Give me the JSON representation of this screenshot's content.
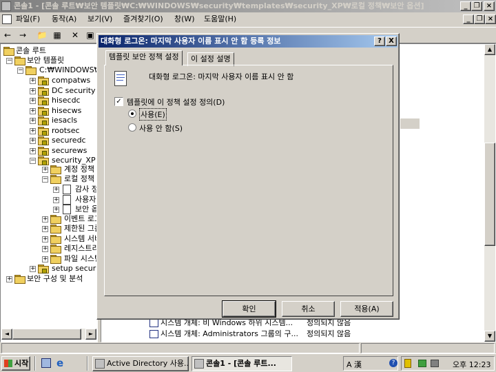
{
  "window": {
    "title": "콘솔1 - [콘솔 루트₩보안 템플릿₩C:₩WINDOWS₩security₩templates₩security_XP₩로컬 정책₩보안 옵션]"
  },
  "menu": {
    "items": [
      "파일(F)",
      "동작(A)",
      "보기(V)",
      "즐겨찾기(O)",
      "창(W)",
      "도움말(H)"
    ]
  },
  "tree": {
    "root": "콘솔 루트",
    "security_templates": "보안 템플릿",
    "templates_path": "C:₩WINDOWS₩security₩templates",
    "templates": [
      "compatws",
      "DC security",
      "hisecdc",
      "hisecws",
      "iesacls",
      "rootsec",
      "securedc",
      "securews",
      "security_XP"
    ],
    "xp_children": [
      "계정 정책",
      "로컬 정책",
      "이벤트 로그",
      "제한된 그룹",
      "시스템 서비스",
      "레지스트리",
      "파일 시스템"
    ],
    "local_policy_children": [
      "감사 정책",
      "사용자 권한 할당",
      "보안 옵션"
    ],
    "setup_security": "setup security",
    "analysis": "보안 구성 및 분석"
  },
  "right_list": {
    "rows": [
      {
        "name": "시스템 개체: 비 Windows 하위 시스템...",
        "value": "정의되지 않음"
      },
      {
        "name": "시스템 개체: Administrators 그룹의 구...",
        "value": "정의되지 않음"
      }
    ]
  },
  "dialog": {
    "title": "대화형 로그온: 마지막 사용자 이름 표시 안 함 등록 정보",
    "tabs": [
      "템플릿 보안 정책 설정",
      "이 설정 설명"
    ],
    "policy_name": "대화형 로그온: 마지막 사용자 이름 표시 안 함",
    "define_checkbox": "템플릿에 이 정책 설정 정의(D)",
    "define_checked": true,
    "radio_enable": "사용(E)",
    "radio_disable": "사용 안 함(S)",
    "selected": "enable",
    "ok": "확인",
    "cancel": "취소",
    "apply": "적용(A)",
    "help": "?",
    "close": "X"
  },
  "taskbar": {
    "start": "시작",
    "tasks": [
      "Active Directory 사용...",
      "콘솔1 - [콘솔 루트..."
    ],
    "ime": "A 漢",
    "clock": "오후 12:23"
  }
}
